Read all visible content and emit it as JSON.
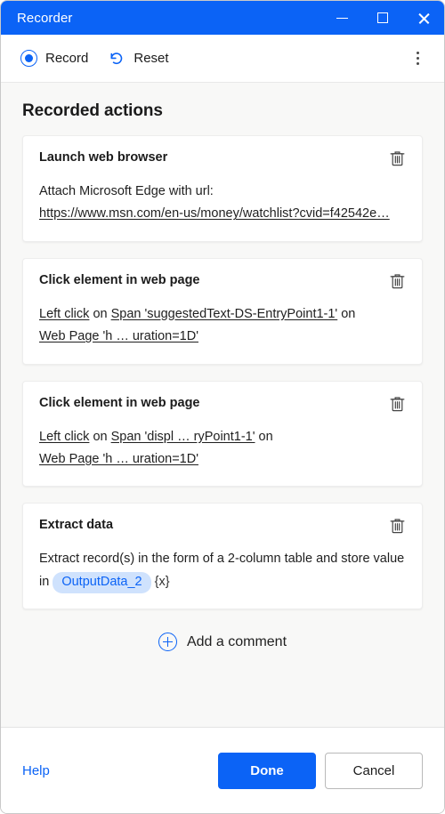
{
  "window": {
    "title": "Recorder",
    "controls": {
      "minimize": "minimize",
      "maximize": "maximize",
      "close": "close"
    },
    "titlebar_color": "#0b63f6"
  },
  "toolbar": {
    "record_label": "Record",
    "reset_label": "Reset",
    "overflow_label": "More options"
  },
  "main": {
    "section_title": "Recorded actions",
    "cards": [
      {
        "title": "Launch web browser",
        "line1": "Attach Microsoft Edge with url:",
        "link": "https://www.msn.com/en-us/money/watchlist?cvid=f42542e…",
        "delete_label": "Delete action"
      },
      {
        "title": "Click element in web page",
        "action": "Left click",
        "connector1": " on ",
        "target": "Span 'suggestedText-DS-EntryPoint1-1'",
        "connector2": " on ",
        "page": "Web Page 'h … uration=1D'",
        "delete_label": "Delete action"
      },
      {
        "title": "Click element in web page",
        "action": "Left click",
        "connector1": " on ",
        "target": "Span 'displ … ryPoint1-1'",
        "connector2": " on ",
        "page": "Web Page 'h … uration=1D'",
        "delete_label": "Delete action"
      },
      {
        "title": "Extract data",
        "text_before": "Extract record(s) in the form of a 2-column table and store value in",
        "variable": "OutputData_2",
        "text_after": "{x}",
        "delete_label": "Delete action"
      }
    ],
    "add_comment_label": "Add a comment"
  },
  "footer": {
    "help_label": "Help",
    "done_label": "Done",
    "cancel_label": "Cancel"
  },
  "colors": {
    "accent": "#0b63f6",
    "chip_bg": "#cfe2fd",
    "content_bg": "#f8f8f7",
    "card_bg": "#ffffff"
  }
}
